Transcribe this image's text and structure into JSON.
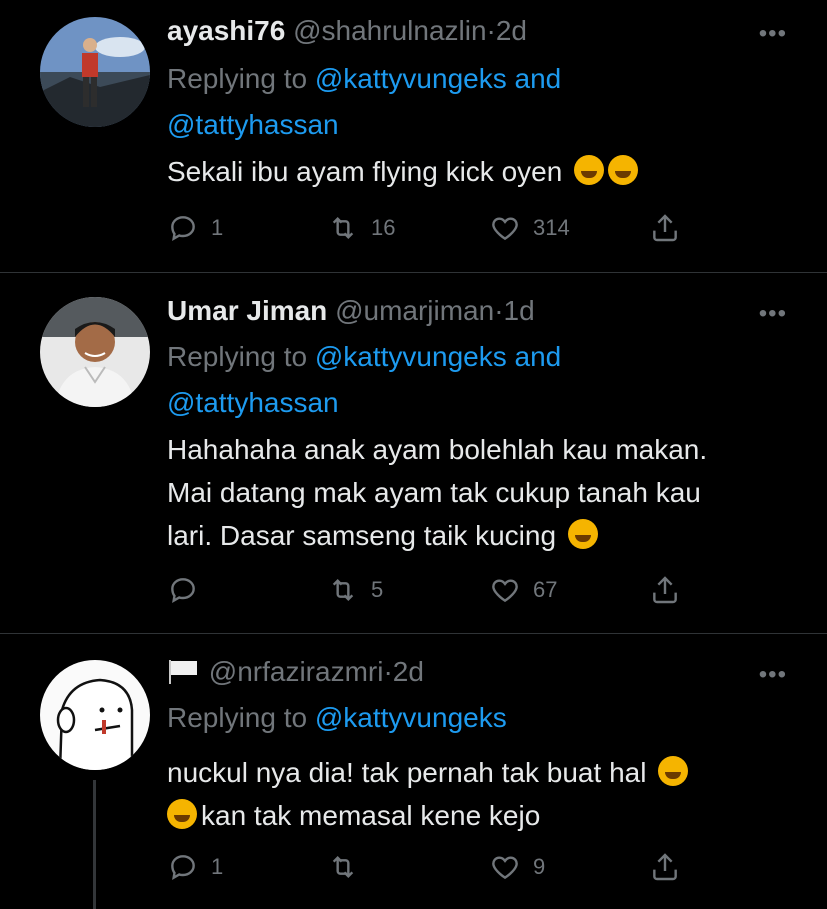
{
  "tweets": [
    {
      "name": "ayashi76",
      "handle": "@shahrulnazlin",
      "time": "2d",
      "replying_prefix": "Replying to",
      "mention1": "@kattyvungeks and",
      "mention2": "@tattyhassan",
      "text": "Sekali ibu ayam flying kick oyen",
      "replies": "1",
      "retweets": "16",
      "likes": "314"
    },
    {
      "name": "Umar Jiman",
      "handle": "@umarjiman",
      "time": "1d",
      "replying_prefix": "Replying to",
      "mention1": "@kattyvungeks and",
      "mention2": "@tattyhassan",
      "text_line1": "Hahahaha anak ayam bolehlah kau makan.",
      "text_line2": "Mai datang mak ayam tak cukup tanah kau",
      "text_line3": "lari. Dasar samseng taik kucing",
      "replies": "",
      "retweets": "5",
      "likes": "67"
    },
    {
      "name": "",
      "handle": "@nrfazirazmri",
      "time": "2d",
      "replying_prefix": "Replying to",
      "mention1": "@kattyvungeks",
      "text_line1": "nuckul nya dia! tak pernah tak buat hal",
      "text_line2": "kan tak memasal kene kejo",
      "replies": "1",
      "retweets": "",
      "likes": "9"
    }
  ],
  "separator": "·",
  "more": "•••",
  "icons": [
    "reply-icon",
    "retweet-icon",
    "like-icon",
    "share-icon",
    "more-icon",
    "flag-icon",
    "rofl-emoji",
    "joy-emoji"
  ],
  "colors": {
    "background": "#000000",
    "text": "#e7e9ea",
    "muted": "#71767b",
    "link": "#1d9bf0",
    "divider": "#2f3336"
  }
}
